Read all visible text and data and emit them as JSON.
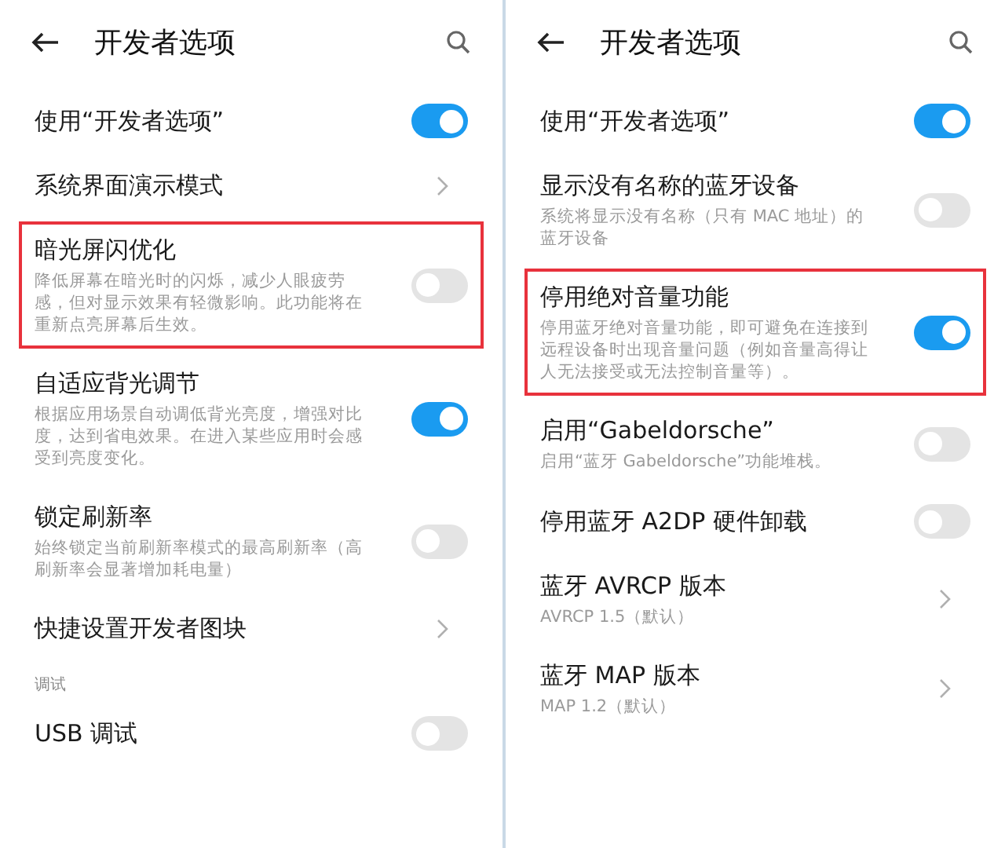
{
  "panels": [
    {
      "title": "开发者选项",
      "items": [
        {
          "kind": "toggle",
          "title": "使用“开发者选项”",
          "on": true
        },
        {
          "kind": "link",
          "title": "系统界面演示模式"
        },
        {
          "kind": "toggle",
          "title": "暗光屏闪优化",
          "subtitle": "降低屏幕在暗光时的闪烁，减少人眼疲劳感，但对显示效果有轻微影响。此功能将在重新点亮屏幕后生效。",
          "on": false,
          "highlighted": true
        },
        {
          "kind": "toggle",
          "title": "自适应背光调节",
          "subtitle": "根据应用场景自动调低背光亮度，增强对比度，达到省电效果。在进入某些应用时会感受到亮度变化。",
          "on": true
        },
        {
          "kind": "toggle",
          "title": "锁定刷新率",
          "subtitle": "始终锁定当前刷新率模式的最高刷新率（高刷新率会显著增加耗电量）",
          "on": false
        },
        {
          "kind": "link",
          "title": "快捷设置开发者图块"
        },
        {
          "kind": "section",
          "title": "调试"
        },
        {
          "kind": "toggle",
          "title": "USB 调试",
          "on": false
        }
      ]
    },
    {
      "title": "开发者选项",
      "items": [
        {
          "kind": "toggle",
          "title": "使用“开发者选项”",
          "on": true
        },
        {
          "kind": "toggle",
          "title": "显示没有名称的蓝牙设备",
          "subtitle": "系统将显示没有名称（只有 MAC 地址）的蓝牙设备",
          "on": false
        },
        {
          "kind": "toggle",
          "title": "停用绝对音量功能",
          "subtitle": "停用蓝牙绝对音量功能，即可避免在连接到远程设备时出现音量问题（例如音量高得让人无法接受或无法控制音量等）。",
          "on": true,
          "highlighted": true
        },
        {
          "kind": "toggle",
          "title": "启用“Gabeldorsche”",
          "subtitle": "启用“蓝牙 Gabeldorsche”功能堆栈。",
          "on": false
        },
        {
          "kind": "toggle",
          "title": "停用蓝牙 A2DP 硬件卸载",
          "on": false
        },
        {
          "kind": "link",
          "title": "蓝牙 AVRCP 版本",
          "subtitle": "AVRCP 1.5（默认）"
        },
        {
          "kind": "link",
          "title": "蓝牙 MAP 版本",
          "subtitle": "MAP 1.2（默认）"
        }
      ]
    }
  ]
}
